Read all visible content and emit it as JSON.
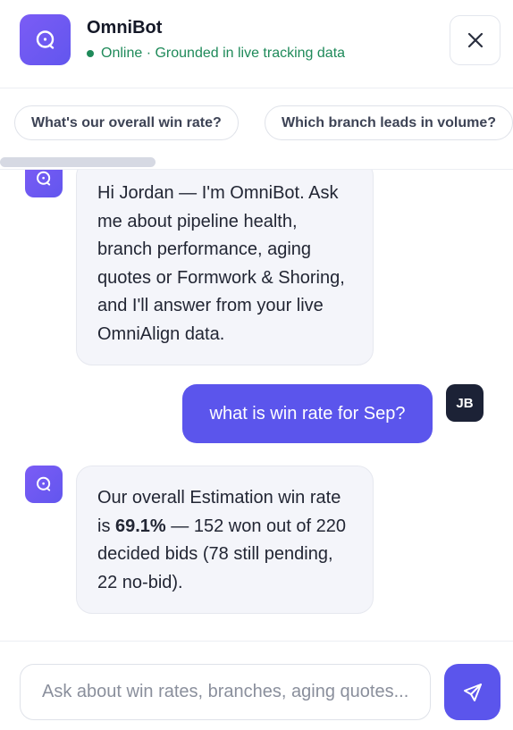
{
  "header": {
    "title": "OmniBot",
    "status": "Online · Grounded in live tracking data"
  },
  "suggestions": [
    "What's our overall win rate?",
    "Which branch leads in volume?"
  ],
  "messages": {
    "bot_intro": "Hi Jordan — I'm OmniBot. Ask me about pipeline health, branch performance, aging quotes or Formwork & Shoring, and I'll answer from your live OmniAlign data.",
    "user_question": "what is win rate for Sep?",
    "user_initials": "JB",
    "bot_answer": {
      "lead": "Our overall Estimation win rate is ",
      "highlight": "69.1%",
      "rest": " — 152 won out of 220 decided bids (78 still pending, 22 no-bid)."
    }
  },
  "composer": {
    "placeholder": "Ask about win rates, branches, aging quotes..."
  },
  "colors": {
    "accent": "#5b55ec",
    "online": "#1f8a5a"
  },
  "icons": {
    "logo": "chat-bubble-icon",
    "close": "close-icon",
    "send": "send-icon"
  }
}
